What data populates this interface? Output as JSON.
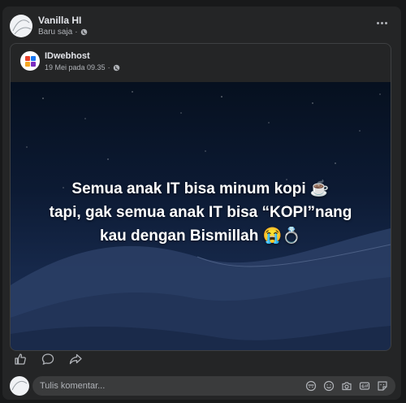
{
  "post": {
    "author": "Vanilla HI",
    "time": "Baru saja",
    "separator": "·",
    "more_icon": "more-horizontal-icon",
    "privacy_icon": "globe-icon"
  },
  "shared_post": {
    "author": "IDwebhost",
    "time": "19 Mei pada 09.35",
    "separator": "·",
    "logo_colors": [
      "#e8412c",
      "#1877f2",
      "#f5a623",
      "#7b2cbf"
    ],
    "image_caption": [
      "Semua anak IT bisa minum kopi ☕",
      "tapi, gak semua anak IT bisa “KOPI”nang",
      "kau dengan Bismillah 😭💍"
    ]
  },
  "actions": [
    {
      "name": "like",
      "icon": "thumbs-up-icon"
    },
    {
      "name": "comment",
      "icon": "comment-icon"
    },
    {
      "name": "share",
      "icon": "share-icon"
    }
  ],
  "comment": {
    "placeholder": "Tulis komentar...",
    "icons": [
      "avatar-sticker-icon",
      "emoji-icon",
      "camera-icon",
      "gif-icon",
      "sticker-icon"
    ]
  },
  "colors": {
    "background": "#18191a",
    "card": "#242526",
    "text_primary": "#e4e6eb",
    "text_secondary": "#b0b3b8"
  }
}
